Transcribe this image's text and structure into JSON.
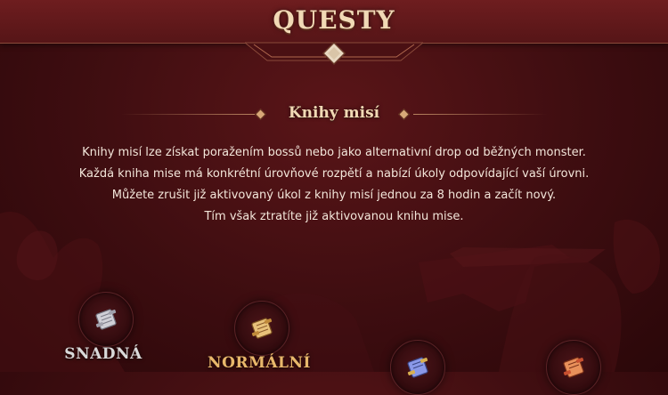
{
  "header": {
    "title": "QUESTY"
  },
  "section": {
    "title": "Knihy misí"
  },
  "description": {
    "lines": [
      "Knihy misí lze získat poražením bossů nebo jako alternativní drop od běžných monster.",
      "Každá kniha mise má konkrétní úrovňové rozpětí a nabízí úkoly odpovídající vaší úrovni.",
      "Můžete zrušit již aktivovaný úkol z knihy misí jednou za 8 hodin a začít nový.",
      "Tím však ztratíte již aktivovanou knihu mise."
    ]
  },
  "difficulties": [
    {
      "label": "SNADNÁ",
      "icon": "scroll-icon",
      "color": "#d9d9d9"
    },
    {
      "label": "NORMÁLNÍ",
      "icon": "scroll-icon",
      "color": "#e8b86b"
    },
    {
      "label": "",
      "icon": "scroll-icon",
      "color": "#6f7fd8"
    },
    {
      "label": "",
      "icon": "scroll-icon",
      "color": "#e07a4a"
    }
  ],
  "colors": {
    "background": "#3d0d10",
    "title": "#f1d9b5",
    "text": "#f3e6da",
    "accent": "#b88460"
  }
}
